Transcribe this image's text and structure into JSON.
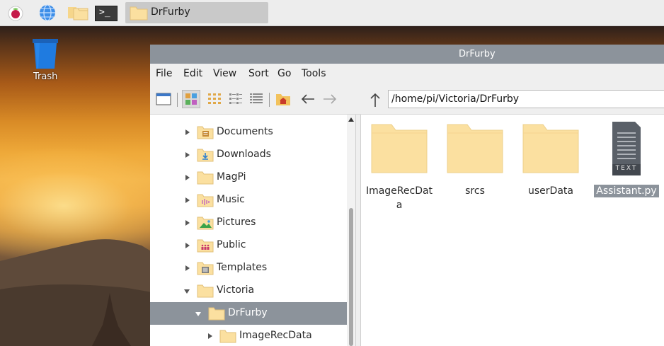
{
  "taskbar": {
    "window_title": "DrFurby",
    "icons": [
      "raspberry-menu-icon",
      "web-browser-icon",
      "file-manager-icon",
      "terminal-icon",
      "folder-icon"
    ],
    "terminal_glyph": ">_"
  },
  "desktop": {
    "trash_label": "Trash"
  },
  "window": {
    "title": "DrFurby",
    "menu": [
      "File",
      "Edit",
      "View",
      "Sort",
      "Go",
      "Tools"
    ],
    "path": "/home/pi/Victoria/DrFurby"
  },
  "sidebar": {
    "items": [
      {
        "label": "Documents",
        "icon": "documents-folder-icon",
        "expanded": false,
        "selected": false,
        "level": 0
      },
      {
        "label": "Downloads",
        "icon": "downloads-folder-icon",
        "expanded": false,
        "selected": false,
        "level": 0
      },
      {
        "label": "MagPi",
        "icon": "folder-icon",
        "expanded": false,
        "selected": false,
        "level": 0
      },
      {
        "label": "Music",
        "icon": "music-folder-icon",
        "expanded": false,
        "selected": false,
        "level": 0
      },
      {
        "label": "Pictures",
        "icon": "pictures-folder-icon",
        "expanded": false,
        "selected": false,
        "level": 0
      },
      {
        "label": "Public",
        "icon": "public-folder-icon",
        "expanded": false,
        "selected": false,
        "level": 0
      },
      {
        "label": "Templates",
        "icon": "templates-folder-icon",
        "expanded": false,
        "selected": false,
        "level": 0
      },
      {
        "label": "Victoria",
        "icon": "folder-icon",
        "expanded": true,
        "selected": false,
        "level": 0
      },
      {
        "label": "DrFurby",
        "icon": "folder-icon",
        "expanded": true,
        "selected": true,
        "level": 1
      },
      {
        "label": "ImageRecData",
        "icon": "folder-icon",
        "expanded": false,
        "selected": false,
        "level": 2
      }
    ]
  },
  "files": [
    {
      "name_line1": "ImageRecDat",
      "name_line2": "a",
      "type": "folder",
      "selected": false
    },
    {
      "name_line1": "srcs",
      "name_line2": "",
      "type": "folder",
      "selected": false
    },
    {
      "name_line1": "userData",
      "name_line2": "",
      "type": "folder",
      "selected": false
    },
    {
      "name_line1": "Assistant.py",
      "name_line2": "",
      "type": "text-file",
      "badge": "TEXT",
      "selected": true
    }
  ],
  "colors": {
    "selection": "#8c939b",
    "folder": "#fbe0a0",
    "titlebar": "#8c939b"
  }
}
